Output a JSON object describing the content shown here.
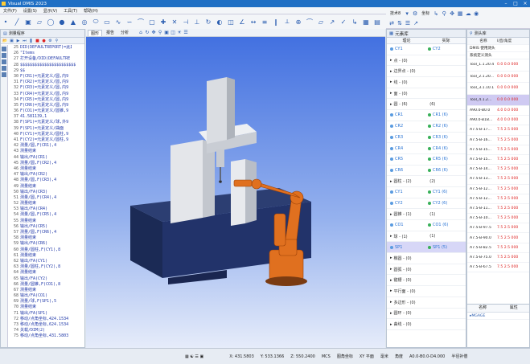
{
  "window": {
    "title": "Visual DMIS 2023"
  },
  "menu": [
    "文件(F)",
    "设置(S)",
    "显示(V)",
    "工具(T)",
    "帮助(H)"
  ],
  "right_toolbar": {
    "label1": "技术8",
    "label2": "坐标"
  },
  "code_panel": {
    "title": "测量程序",
    "lines": [
      {
        "n": "25",
        "t": "DID(DEFAULTREPORT)=此】"
      },
      {
        "n": "26",
        "t": "                 \"Items"
      },
      {
        "n": "27",
        "t": "打开设备/DID(DEFAULTRE"
      },
      {
        "n": "28",
        "t": "$$$$$$$$$$$$$$$$$$$$$$$"
      },
      {
        "n": "29",
        "t": "$$"
      },
      {
        "n": "30",
        "t": "F(CR1)=元素定义/圆,内9"
      },
      {
        "n": "31",
        "t": "F(CR2)=元素定义/圆,内9"
      },
      {
        "n": "32",
        "t": "F(CR3)=元素定义/圆,内9"
      },
      {
        "n": "33",
        "t": "F(CR4)=元素定义/圆,内9"
      },
      {
        "n": "34",
        "t": "F(CR5)=元素定义/圆,内9"
      },
      {
        "n": "35",
        "t": "F(CR6)=元素定义/圆,内9"
      },
      {
        "n": "36",
        "t": "F(CO1)=元素定义/圆锥,9"
      },
      {
        "n": "37",
        "t": "             41.581139,1"
      },
      {
        "n": "38",
        "t": "F(SP1)=元素定义/球,外9"
      },
      {
        "n": "39",
        "t": "F(SP1)=元素定义/曲面"
      },
      {
        "n": "40",
        "t": "F(CY1)=元素定义/圆柱,9"
      },
      {
        "n": "41",
        "t": "F(CY2)=元素定义/圆柱,9"
      },
      {
        "n": "42",
        "t": "测量/圆,F(CR1),4"
      },
      {
        "n": "43",
        "t": "测量结束"
      },
      {
        "n": "44",
        "t": "输出/FA(CR1)"
      },
      {
        "n": "45",
        "t": "测量/圆,F(CR2),4"
      },
      {
        "n": "46",
        "t": "测量结束"
      },
      {
        "n": "47",
        "t": "输出/FA(CR2)"
      },
      {
        "n": "48",
        "t": "测量/圆,F(CR3),4"
      },
      {
        "n": "49",
        "t": "测量结束"
      },
      {
        "n": "50",
        "t": "输出/FA(CR3)"
      },
      {
        "n": "51",
        "t": "测量/圆,F(CR4),4"
      },
      {
        "n": "52",
        "t": "测量结束"
      },
      {
        "n": "53",
        "t": "输出/FA(CR4)"
      },
      {
        "n": "54",
        "t": "测量/圆,F(CR5),4"
      },
      {
        "n": "55",
        "t": "测量结束"
      },
      {
        "n": "56",
        "t": "输出/FA(CR5)"
      },
      {
        "n": "57",
        "t": "测量/圆,F(CR6),4"
      },
      {
        "n": "58",
        "t": "测量结束"
      },
      {
        "n": "59",
        "t": "输出/FA(CR6)"
      },
      {
        "n": "60",
        "t": "测量/圆柱,F(CY1),8"
      },
      {
        "n": "61",
        "t": "测量结束"
      },
      {
        "n": "62",
        "t": "输出/FA(CY1)"
      },
      {
        "n": "63",
        "t": "测量/圆柱,F(CY2),8"
      },
      {
        "n": "64",
        "t": "测量结束"
      },
      {
        "n": "65",
        "t": "输出/FA(CY2)"
      },
      {
        "n": "66",
        "t": "测量/圆锥,F(CO1),8"
      },
      {
        "n": "67",
        "t": "测量结束"
      },
      {
        "n": "68",
        "t": "输出/FA(CO1)"
      },
      {
        "n": "69",
        "t": "测量/球,F(SP1),5"
      },
      {
        "n": "70",
        "t": "测量结束"
      },
      {
        "n": "71",
        "t": "输出/FA(SP1)"
      },
      {
        "n": "72",
        "t": "移动/点角坐标,424.1534"
      },
      {
        "n": "73",
        "t": "移动/点角坐标,624.1534"
      },
      {
        "n": "74",
        "t": "关载/DIM(2)"
      },
      {
        "n": "75",
        "t": "移动/点角坐标,431.5803"
      }
    ]
  },
  "viewport": {
    "tabs": [
      "图形",
      "报告",
      "分析"
    ]
  },
  "element_panel": {
    "title": "元素库",
    "col1": "理论",
    "col2": "实际",
    "rows": [
      {
        "a": "CY1",
        "b": "CY2",
        "sub": true,
        "dot": "#2a74d4",
        "dot2": "#2da84e"
      },
      {
        "a": "点 - (0)",
        "b": ""
      },
      {
        "a": "边界点 - (0)",
        "b": ""
      },
      {
        "a": "线 - (0)",
        "b": ""
      },
      {
        "a": "面 - (0)",
        "b": ""
      },
      {
        "a": "圆 - (6)",
        "b": "(6)"
      },
      {
        "a": "CR1",
        "b": "CR1 (6)",
        "sub": true
      },
      {
        "a": "CR2",
        "b": "CR2 (6)",
        "sub": true
      },
      {
        "a": "CR3",
        "b": "CR3 (6)",
        "sub": true
      },
      {
        "a": "CR4",
        "b": "CR4 (6)",
        "sub": true
      },
      {
        "a": "CR5",
        "b": "CR5 (6)",
        "sub": true
      },
      {
        "a": "CR6",
        "b": "CR6 (6)",
        "sub": true
      },
      {
        "a": "圆柱 - (2)",
        "b": "(2)"
      },
      {
        "a": "CY1",
        "b": "CY1 (6)",
        "sub": true
      },
      {
        "a": "CY2",
        "b": "CY2 (6)",
        "sub": true
      },
      {
        "a": "圆锥 - (1)",
        "b": "(1)"
      },
      {
        "a": "CO1",
        "b": "CO1 (6)",
        "sub": true
      },
      {
        "a": "球 - (1)",
        "b": "(1)"
      },
      {
        "a": "SP1",
        "b": "SP1 (5)",
        "sub": true,
        "sel": true
      },
      {
        "a": "椭圆 - (0)",
        "b": ""
      },
      {
        "a": "圆弧 - (0)",
        "b": ""
      },
      {
        "a": "键槽 - (0)",
        "b": ""
      },
      {
        "a": "平行面 - (0)",
        "b": ""
      },
      {
        "a": "多边形 - (0)",
        "b": ""
      },
      {
        "a": "圆环 - (0)",
        "b": ""
      },
      {
        "a": "曲线 - (0)",
        "b": ""
      }
    ]
  },
  "probe_panel": {
    "title": "测头库",
    "col1": "名称",
    "col2": "I/直/角度",
    "header_rows": [
      "DMIS 使用测头",
      "系统定义测头"
    ],
    "tools": [
      {
        "nm": "Tool_1.1.20.4",
        "vl": "0.0 0.0 000",
        "sel": false
      },
      {
        "nm": "Tool_2.1.20...",
        "vl": "0.0 0.0 000",
        "sel": false
      },
      {
        "nm": "Tool_3.1.10.1",
        "vl": "0.0 0.0 000",
        "sel": false
      },
      {
        "nm": "Tool_4.1.2...",
        "vl": "0.0 0.0 000",
        "sel": true
      }
    ],
    "rows": [
      {
        "nm": "A90.0-B0.0",
        "vl": "4.0 0.0 000"
      },
      {
        "nm": "A90.0-B18...",
        "vl": "4.0 0.0 000"
      },
      {
        "nm": "A7.5-B-17...",
        "vl": "7.5 2.5 000"
      },
      {
        "nm": "A7.5-B-16...",
        "vl": "7.5 2.5 000"
      },
      {
        "nm": "A7.5-B-15...",
        "vl": "7.5 2.5 000"
      },
      {
        "nm": "A7.5-B-15...",
        "vl": "7.5 2.5 000"
      },
      {
        "nm": "A7.5-B-14...",
        "vl": "7.5 2.5 000"
      },
      {
        "nm": "A7.5-B-13...",
        "vl": "7.5 2.5 000"
      },
      {
        "nm": "A7.5-B-12...",
        "vl": "7.5 2.5 000"
      },
      {
        "nm": "A7.5-B-12...",
        "vl": "7.5 2.5 000"
      },
      {
        "nm": "A7.5-B-11...",
        "vl": "7.5 2.5 000"
      },
      {
        "nm": "A7.5-B-10...",
        "vl": "7.5 2.5 000"
      },
      {
        "nm": "A7.5-B-97.5",
        "vl": "7.5 2.5 000"
      },
      {
        "nm": "A7.5-B-90.0",
        "vl": "7.5 2.5 000"
      },
      {
        "nm": "A7.5-B-82.5",
        "vl": "7.5 2.5 000"
      },
      {
        "nm": "A7.5-B-75.0",
        "vl": "7.5 2.5 000"
      },
      {
        "nm": "A7.5-B-67.5",
        "vl": "7.5 2.5 000"
      }
    ]
  },
  "props_panel": {
    "col1": "名称",
    "col2": "属性",
    "item": "MGAGE"
  },
  "status": {
    "x": "X: 431.5803",
    "y": "Y: 533.1366",
    "z": "Z: 550.2400",
    "mcs": "MCS",
    "mode": "图角坐标",
    "plane": "XY 平面",
    "unit": "毫米",
    "angle": "角度",
    "probe": "A0.0-B0.0-D4.000",
    "comp": "半径补偿"
  }
}
